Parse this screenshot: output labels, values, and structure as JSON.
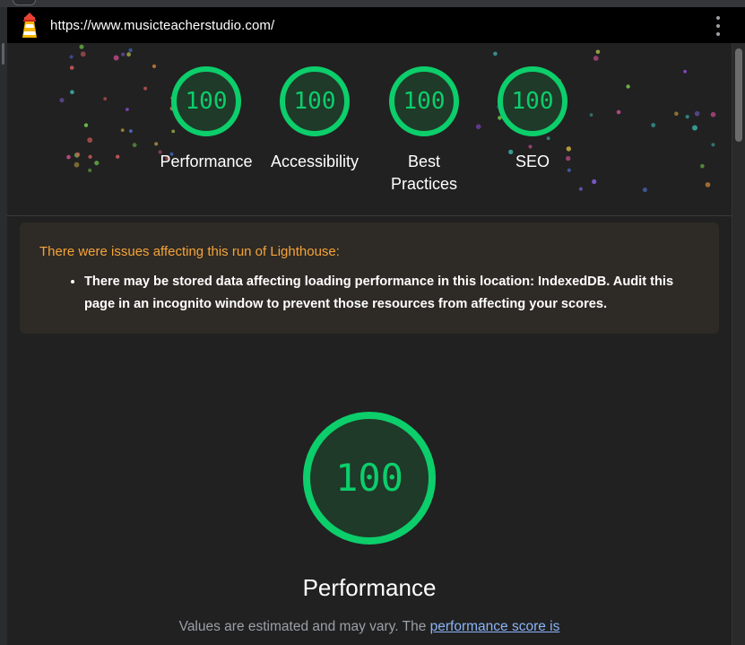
{
  "browser": {
    "url": "https://www.musicteacherstudio.com/"
  },
  "summary": {
    "gauges": [
      {
        "label": "Performance",
        "score": "100"
      },
      {
        "label": "Accessibility",
        "score": "100"
      },
      {
        "label": "Best Practices",
        "score": "100"
      },
      {
        "label": "SEO",
        "score": "100"
      }
    ]
  },
  "warning": {
    "heading": "There were issues affecting this run of Lighthouse:",
    "items": [
      "There may be stored data affecting loading performance in this location: IndexedDB. Audit this page in an incognito window to prevent those resources from affecting your scores."
    ]
  },
  "performance": {
    "score": "100",
    "title": "Performance",
    "note_prefix": "Values are estimated and may vary. The",
    "note_link": "performance score is"
  },
  "colors": {
    "pass": "#0cce6b",
    "warning_text": "#f5a43a",
    "link": "#8ab4f8"
  },
  "icons": {
    "logo": "lighthouse-icon",
    "menu": "more-vertical-icon"
  }
}
